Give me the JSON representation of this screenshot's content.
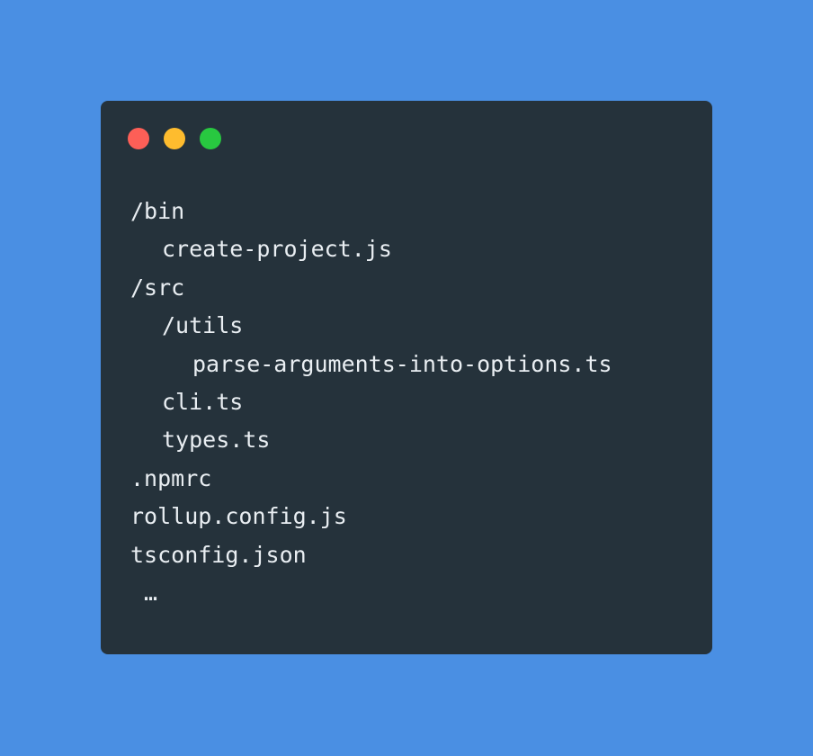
{
  "window": {
    "controls": [
      {
        "name": "close",
        "color": "#fd5f57"
      },
      {
        "name": "minimize",
        "color": "#febc2e"
      },
      {
        "name": "maximize",
        "color": "#28c840"
      }
    ]
  },
  "code": {
    "lines": [
      {
        "text": "/bin",
        "indent": 0
      },
      {
        "text": "create-project.js",
        "indent": 1
      },
      {
        "text": "/src",
        "indent": 0
      },
      {
        "text": "/utils",
        "indent": 1
      },
      {
        "text": "parse-arguments-into-options.ts",
        "indent": 2
      },
      {
        "text": "cli.ts",
        "indent": 1
      },
      {
        "text": "types.ts",
        "indent": 1
      },
      {
        "text": ".npmrc",
        "indent": 0
      },
      {
        "text": "rollup.config.js",
        "indent": 0
      },
      {
        "text": "tsconfig.json",
        "indent": 0
      },
      {
        "text": " …",
        "indent": 0
      }
    ]
  },
  "colors": {
    "background": "#4a8fe3",
    "window": "#25323b",
    "text": "#e9eef2"
  }
}
